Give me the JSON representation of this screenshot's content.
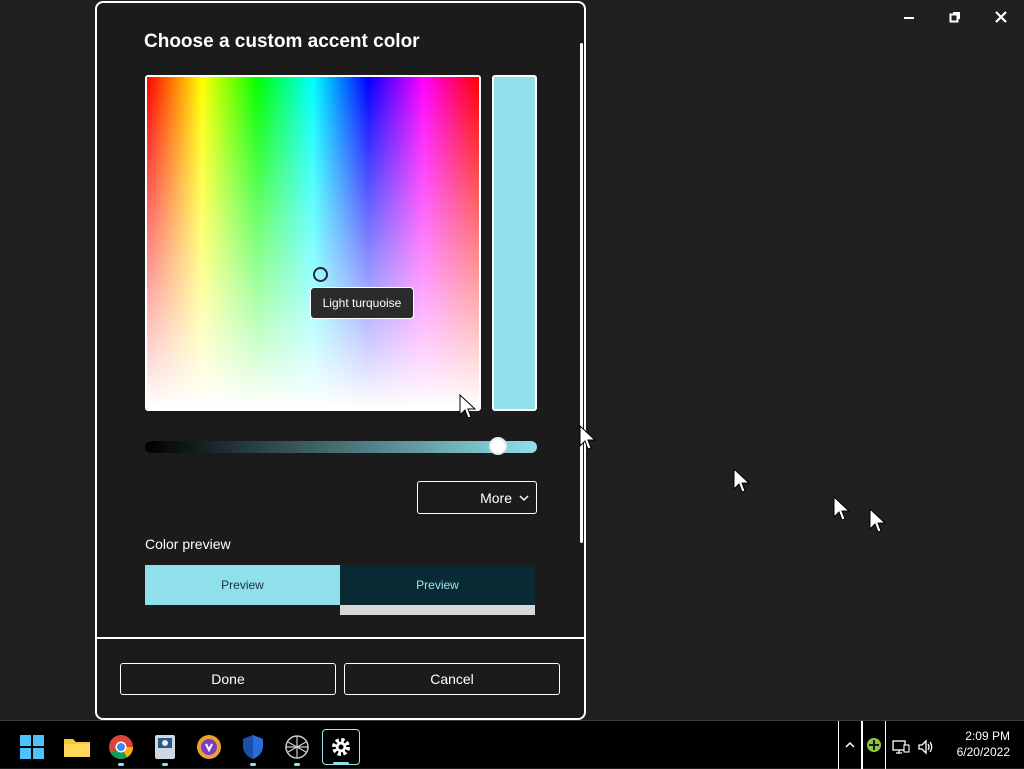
{
  "window_controls": {
    "minimize_icon": "minimize-icon",
    "restore_icon": "restore-icon",
    "close_icon": "close-icon"
  },
  "dialog": {
    "title": "Choose a custom accent color",
    "tooltip": "Light turquoise",
    "selected_color": "#8fe0ea",
    "value_slider_level": 0.92,
    "more_label": "More",
    "color_preview_label": "Color preview",
    "preview_light_label": "Preview",
    "preview_dark_label": "Preview",
    "done_label": "Done",
    "cancel_label": "Cancel"
  },
  "taskbar": {
    "apps": [
      {
        "name": "start",
        "icon": "windows-start-icon"
      },
      {
        "name": "file-explorer",
        "icon": "folder-icon"
      },
      {
        "name": "chrome",
        "icon": "chrome-icon"
      },
      {
        "name": "app-4",
        "icon": "app-icon"
      },
      {
        "name": "app-5",
        "icon": "vpn-icon"
      },
      {
        "name": "security",
        "icon": "shield-icon"
      },
      {
        "name": "app-7",
        "icon": "network-icon"
      },
      {
        "name": "settings",
        "icon": "gear-icon"
      }
    ],
    "clock_time": "2:09 PM",
    "clock_date": "6/20/2022"
  },
  "colors": {
    "accent": "#8fe0ea",
    "dark_preview": "#0a2a33",
    "background": "#202020"
  }
}
